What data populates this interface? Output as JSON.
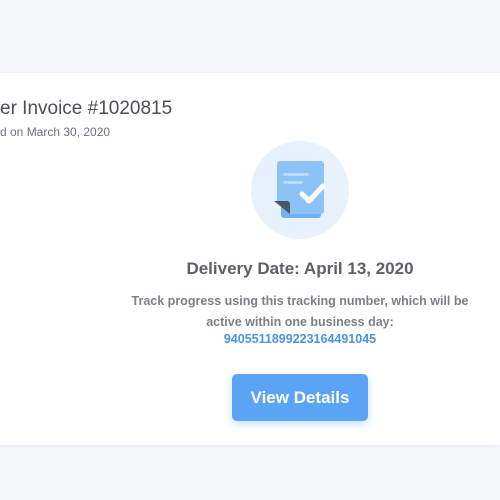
{
  "invoice": {
    "title": "er Invoice #1020815",
    "subtitle": "d on March 30, 2020"
  },
  "icon": {
    "name": "document-check-icon",
    "bg_color": "#e8f2fd",
    "doc_color": "#8cc3f6",
    "accent_color": "#5ba4f5"
  },
  "delivery": {
    "date_label": "Delivery Date: April 13, 2020",
    "track_text": "Track progress using this tracking number, which will be active within one business day:",
    "tracking_number": "9405511899223164491045"
  },
  "actions": {
    "view_details_label": "View Details"
  },
  "colors": {
    "page_bg": "#f4f6f9",
    "card_bg": "#ffffff",
    "link": "#4b93dd",
    "button": "#5ba4f5"
  }
}
